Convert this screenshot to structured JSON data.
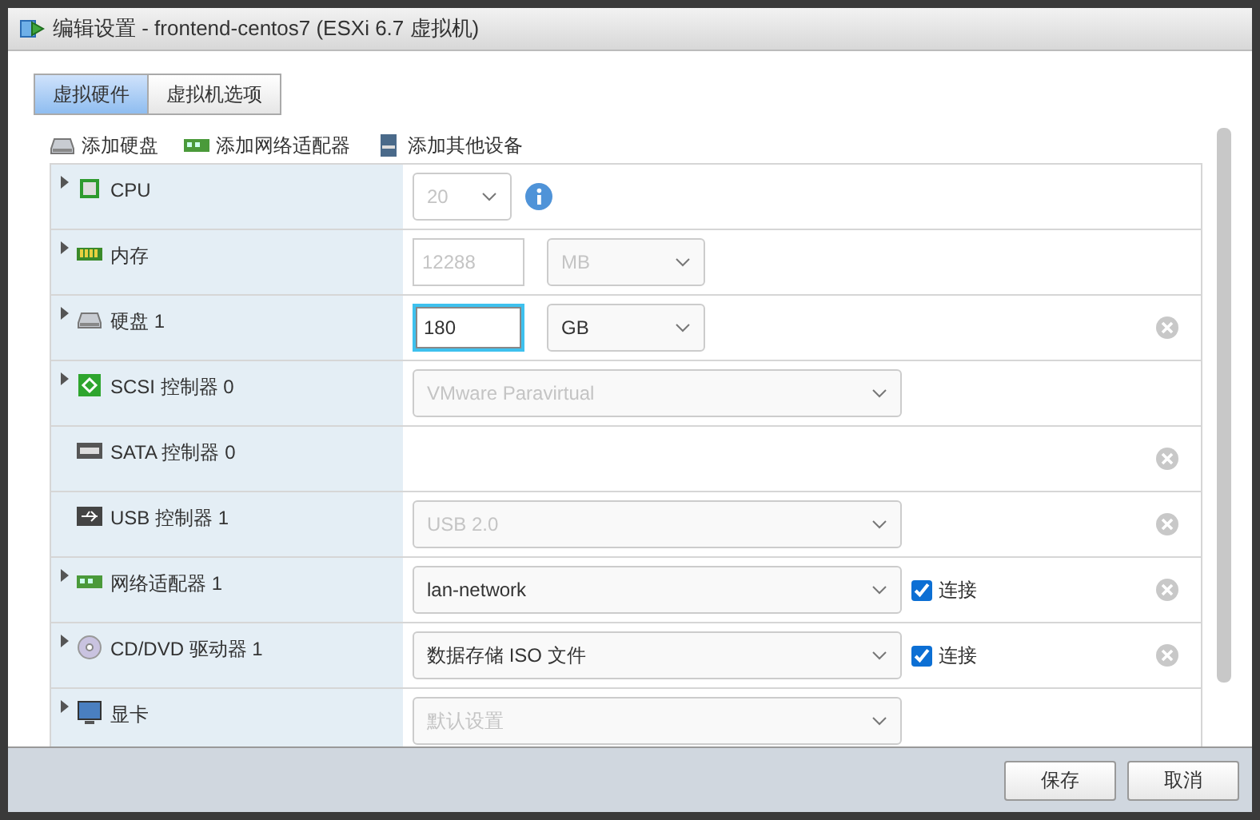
{
  "window": {
    "title": "编辑设置 - frontend-centos7 (ESXi 6.7 虚拟机)"
  },
  "tabs": [
    {
      "label": "虚拟硬件",
      "selected": true
    },
    {
      "label": "虚拟机选项",
      "selected": false
    }
  ],
  "toolbar": [
    {
      "kind": "disk",
      "label": "添加硬盘"
    },
    {
      "kind": "network",
      "label": "添加网络适配器"
    },
    {
      "kind": "other",
      "label": "添加其他设备"
    }
  ],
  "devices": [
    {
      "kind": "cpu",
      "label": "CPU",
      "expandable": true,
      "removable": false,
      "controls": [
        {
          "kind": "select",
          "value": "20",
          "disabled": true
        },
        {
          "kind": "info"
        }
      ]
    },
    {
      "kind": "memory",
      "label": "内存",
      "expandable": true,
      "removable": false,
      "controls": [
        {
          "kind": "input",
          "value": "12288",
          "disabled": true,
          "focused": false
        },
        {
          "kind": "select",
          "value": "MB",
          "disabled": true
        }
      ]
    },
    {
      "kind": "disk",
      "label": "硬盘 1",
      "expandable": true,
      "removable": true,
      "controls": [
        {
          "kind": "input",
          "value": "180",
          "disabled": false,
          "focused": true
        },
        {
          "kind": "select",
          "value": "GB",
          "disabled": false
        }
      ]
    },
    {
      "kind": "scsi",
      "label": "SCSI 控制器 0",
      "expandable": true,
      "removable": false,
      "controls": [
        {
          "kind": "select",
          "value": "VMware Paravirtual",
          "disabled": true
        }
      ]
    },
    {
      "kind": "sata",
      "label": "SATA 控制器 0",
      "expandable": false,
      "removable": true
    },
    {
      "kind": "usb",
      "label": "USB 控制器 1",
      "expandable": false,
      "removable": true,
      "controls": [
        {
          "kind": "select",
          "value": "USB 2.0",
          "disabled": true
        }
      ]
    },
    {
      "kind": "network",
      "label": "网络适配器 1",
      "expandable": true,
      "removable": true,
      "controls": [
        {
          "kind": "select",
          "value": "lan-network",
          "disabled": false
        },
        {
          "kind": "checkbox",
          "label": "连接",
          "checked": true
        }
      ]
    },
    {
      "kind": "cdrom",
      "label": "CD/DVD 驱动器 1",
      "expandable": true,
      "removable": true,
      "controls": [
        {
          "kind": "select",
          "value": "数据存储 ISO 文件",
          "disabled": false
        },
        {
          "kind": "checkbox",
          "label": "连接",
          "checked": true
        }
      ]
    },
    {
      "kind": "video",
      "label": "显卡",
      "expandable": true,
      "removable": false,
      "controls": [
        {
          "kind": "select",
          "value": "默认设置",
          "disabled": true
        }
      ]
    }
  ],
  "buttons": [
    {
      "label": "保存"
    },
    {
      "label": "取消"
    }
  ]
}
